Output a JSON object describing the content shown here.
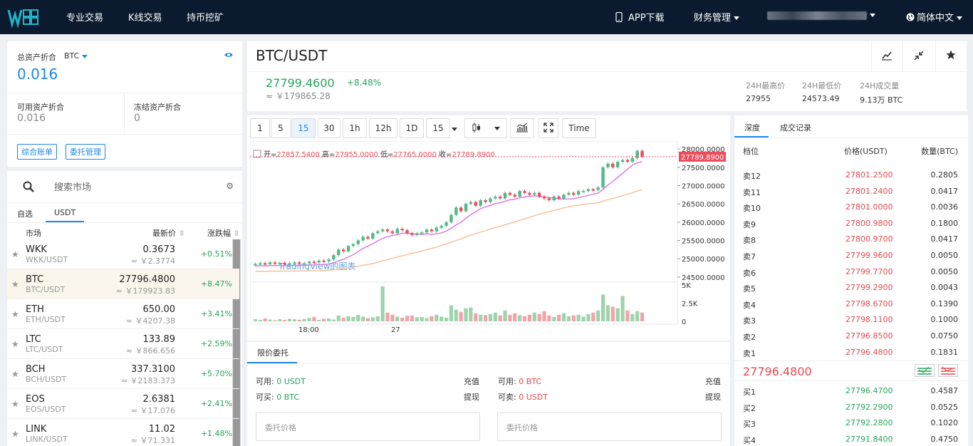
{
  "nav": {
    "logo_text": "WKK",
    "items": [
      "专业交易",
      "K线交易",
      "持币挖矿"
    ],
    "app_download": "APP下载",
    "finance": "财务管理",
    "language": "简体中文"
  },
  "assets": {
    "total_label": "总资产折合",
    "unit": "BTC",
    "total_value": "0.016",
    "available_label": "可用资产折合",
    "available_value": "0.016",
    "frozen_label": "冻结资产折合",
    "frozen_value": "0",
    "btn_account": "综合账单",
    "btn_orders": "委托管理"
  },
  "market": {
    "search_placeholder": "搜索市场",
    "tabs": [
      "自选",
      "USDT"
    ],
    "col_market": "市场",
    "col_price": "最新价",
    "col_change": "涨跌幅",
    "rows": [
      {
        "coin": "WKK",
        "pair": "WKK/USDT",
        "price": "0.3673",
        "cny": "≈ ￥2.3774",
        "change": "+0.51%"
      },
      {
        "coin": "BTC",
        "pair": "BTC/USDT",
        "price": "27796.4800",
        "cny": "≈ ￥179923.83",
        "change": "+8.47%"
      },
      {
        "coin": "ETH",
        "pair": "ETH/USDT",
        "price": "650.00",
        "cny": "≈ ￥4207.38",
        "change": "+3.41%"
      },
      {
        "coin": "LTC",
        "pair": "LTC/USDT",
        "price": "133.89",
        "cny": "≈ ￥866.656",
        "change": "+2.59%"
      },
      {
        "coin": "BCH",
        "pair": "BCH/USDT",
        "price": "337.3100",
        "cny": "≈ ￥2183.373",
        "change": "+5.70%"
      },
      {
        "coin": "EOS",
        "pair": "EOS/USDT",
        "price": "2.6381",
        "cny": "≈ ￥17.076",
        "change": "+2.41%"
      },
      {
        "coin": "LINK",
        "pair": "LINK/USDT",
        "price": "11.02",
        "cny": "≈ ￥71.331",
        "change": "+1.48%"
      }
    ]
  },
  "ticker": {
    "pair": "BTC/USDT",
    "last": "27799.4600",
    "cny": "≈ ￥179865.28",
    "change": "+8.48%",
    "high_label": "24H最高价",
    "high": "27955",
    "low_label": "24H最低价",
    "low": "24573.49",
    "vol_label": "24H成交量",
    "vol": "9.13万 BTC"
  },
  "chart_toolbar": {
    "intervals": [
      "1",
      "5",
      "15",
      "30",
      "1h",
      "12h",
      "1D",
      "15"
    ],
    "time_btn": "Time"
  },
  "chart_data": {
    "type": "candlestick",
    "legend": {
      "open": "27857.5400",
      "high": "27955.0000",
      "low": "27765.0000",
      "close": "27789.8900",
      "open_label": "开=",
      "high_label": "高=",
      "low_label": "低=",
      "close_label": "收="
    },
    "last_price_tag": "27789.8900",
    "y_ticks": [
      "28000.0000",
      "27500.0000",
      "27000.0000",
      "26500.0000",
      "26000.0000",
      "25500.0000",
      "25000.0000",
      "24500.0000"
    ],
    "ylim": [
      24400,
      28100
    ],
    "vol_ticks": [
      "5K",
      "2.5K",
      "0"
    ],
    "x_ticks": [
      "18:00",
      "27"
    ],
    "watermark": "TradingView的图表",
    "closes": [
      24860,
      24880,
      24850,
      24900,
      24870,
      24890,
      24860,
      24880,
      24900,
      24870,
      24880,
      24920,
      24900,
      24950,
      24930,
      24980,
      25100,
      25250,
      25200,
      25350,
      25400,
      25500,
      25600,
      25550,
      25700,
      25750,
      25800,
      25750,
      25700,
      25820,
      25780,
      25700,
      25650,
      25700,
      25720,
      25800,
      25750,
      25850,
      25900,
      26000,
      26200,
      26400,
      26300,
      26500,
      26550,
      26450,
      26600,
      26550,
      26650,
      26700,
      26650,
      26800,
      26750,
      26700,
      26850,
      26800,
      26750,
      26800,
      26700,
      26650,
      26600,
      26700,
      26650,
      26750,
      26800,
      26750,
      26850,
      26850,
      26900,
      26880,
      26950,
      27500,
      27600,
      27500,
      27650,
      27700,
      27650,
      27750,
      27950,
      27790
    ],
    "volumes": [
      300,
      200,
      400,
      250,
      150,
      300,
      200,
      350,
      280,
      220,
      300,
      450,
      600,
      200,
      350,
      400,
      250,
      800,
      500,
      700,
      600,
      900,
      650,
      450,
      550,
      700,
      4800,
      1200,
      900,
      650,
      500,
      750,
      800,
      550,
      600,
      450,
      700,
      900,
      650,
      500,
      2200,
      1600,
      1300,
      1800,
      1900,
      1100,
      900,
      850,
      1000,
      1200,
      800,
      1500,
      900,
      1100,
      850,
      700,
      900,
      1200,
      1000,
      1400,
      800,
      600,
      900,
      1100,
      700,
      800,
      900,
      650,
      1000,
      1200,
      1500,
      3700,
      2200,
      2000,
      1800,
      3500,
      1500,
      1000,
      1400,
      1200
    ]
  },
  "order_form": {
    "tab": "限价委托",
    "buy": {
      "available_label": "可用:",
      "available": "0 USDT",
      "can_buy_label": "可买:",
      "can_buy": "0 BTC",
      "deposit": "充值",
      "withdraw": "提现",
      "price_placeholder": "委托价格"
    },
    "sell": {
      "available_label": "可用:",
      "available": "0 BTC",
      "can_sell_label": "可卖:",
      "can_sell": "0 USDT",
      "deposit": "充值",
      "withdraw": "提现",
      "price_placeholder": "委托价格"
    }
  },
  "orderbook": {
    "tabs": [
      "深度",
      "成交记录"
    ],
    "col_level": "档位",
    "col_price": "价格(USDT)",
    "col_qty": "数量(BTC)",
    "asks": [
      {
        "label": "卖12",
        "price": "27801.2500",
        "qty": "0.2805"
      },
      {
        "label": "卖11",
        "price": "27801.2400",
        "qty": "0.0417"
      },
      {
        "label": "卖10",
        "price": "27801.0000",
        "qty": "0.0036"
      },
      {
        "label": "卖9",
        "price": "27800.9800",
        "qty": "0.1800"
      },
      {
        "label": "卖8",
        "price": "27800.9700",
        "qty": "0.0417"
      },
      {
        "label": "卖7",
        "price": "27799.9600",
        "qty": "0.0050"
      },
      {
        "label": "卖6",
        "price": "27799.7700",
        "qty": "0.0050"
      },
      {
        "label": "卖5",
        "price": "27799.2900",
        "qty": "0.0043"
      },
      {
        "label": "卖4",
        "price": "27798.6700",
        "qty": "0.1390"
      },
      {
        "label": "卖3",
        "price": "27798.1100",
        "qty": "0.1000"
      },
      {
        "label": "卖2",
        "price": "27796.8500",
        "qty": "0.0750"
      },
      {
        "label": "卖1",
        "price": "27796.4800",
        "qty": "0.1831"
      }
    ],
    "last_price": "27796.4800",
    "bids": [
      {
        "label": "买1",
        "price": "27796.4700",
        "qty": "0.4587"
      },
      {
        "label": "买2",
        "price": "27792.2900",
        "qty": "0.0525"
      },
      {
        "label": "买3",
        "price": "27792.2800",
        "qty": "0.1020"
      },
      {
        "label": "买4",
        "price": "27791.8400",
        "qty": "0.4750"
      }
    ]
  },
  "colors": {
    "accent": "#1e88e5",
    "up": "#26a65b",
    "down": "#e8484d",
    "nav_bg": "#0b1a2e"
  }
}
